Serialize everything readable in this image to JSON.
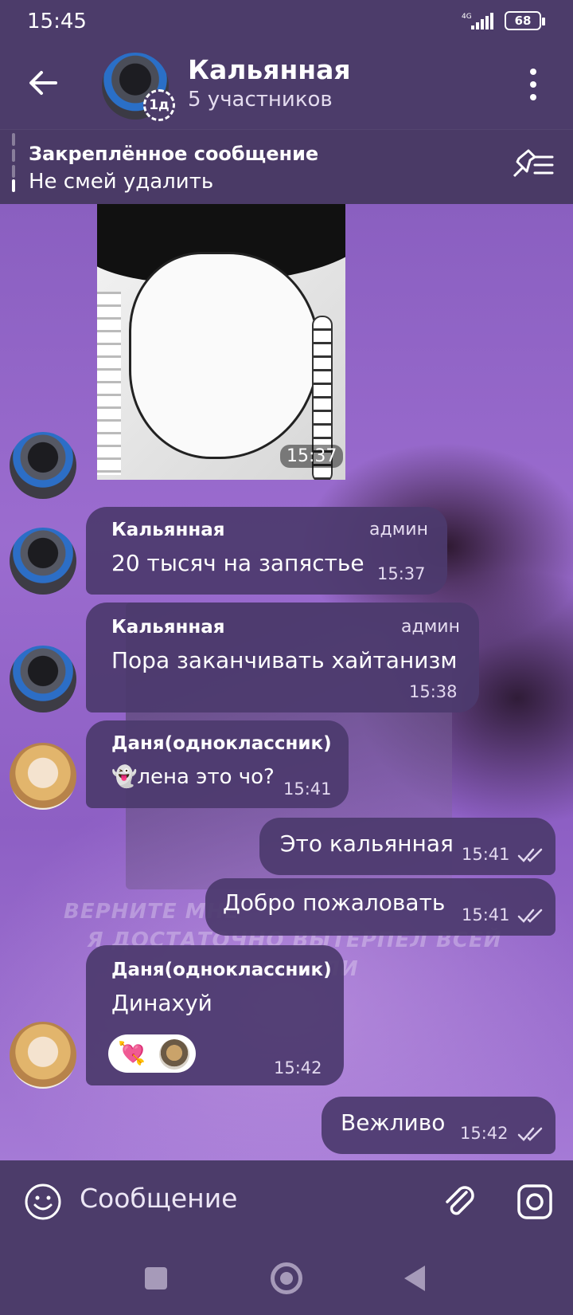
{
  "status_bar": {
    "time": "15:45",
    "network": "4G",
    "battery": "68"
  },
  "header": {
    "title": "Кальянная",
    "subtitle": "5 участников",
    "story_badge": "1д"
  },
  "pinned": {
    "title": "Закреплённое сообщение",
    "text": "Не смей удалить"
  },
  "background": {
    "caption_line1": "ВЕРНИТЕ МНЕ",
    "caption_line2": "Я ДОСТАТОЧНО ВЫТЕРПЕЛ ВСЕЙ ЭТО БОЛИ"
  },
  "messages": [
    {
      "type": "photo",
      "time": "15:37"
    },
    {
      "sender": "Кальянная",
      "role": "админ",
      "text": "20 тысяч на запястье",
      "time": "15:37"
    },
    {
      "sender": "Кальянная",
      "role": "админ",
      "text": "Пора заканчивать хайтанизм",
      "time": "15:38"
    },
    {
      "sender": "Даня(одноклассник)",
      "text": "👻лена это чо?",
      "time": "15:41"
    },
    {
      "outgoing": true,
      "text": "Это кальянная",
      "time": "15:41"
    },
    {
      "outgoing": true,
      "text": "Добро пожаловать",
      "time": "15:41"
    },
    {
      "sender": "Даня(одноклассник)",
      "text": "Динахуй",
      "time": "15:42",
      "reaction": "💘"
    },
    {
      "outgoing": true,
      "text": "Вежливо",
      "time": "15:42"
    }
  ],
  "input": {
    "placeholder": "Сообщение"
  },
  "colors": {
    "bar": "#4c3c6a",
    "bubble": "#4c3a6e",
    "chat_bg": "#9b6ccf"
  }
}
